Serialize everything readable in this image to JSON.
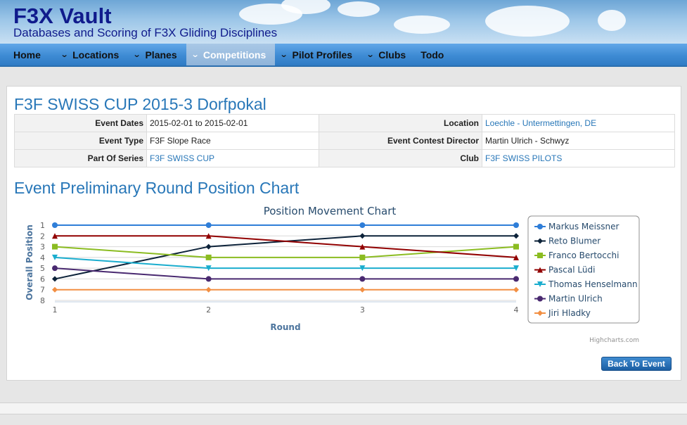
{
  "site": {
    "title": "F3X Vault",
    "subtitle": "Databases and Scoring of F3X Gliding Disciplines"
  },
  "nav": {
    "items": [
      {
        "label": "Home",
        "dropdown": false,
        "active": false
      },
      {
        "label": "Locations",
        "dropdown": true,
        "active": false
      },
      {
        "label": "Planes",
        "dropdown": true,
        "active": false
      },
      {
        "label": "Competitions",
        "dropdown": true,
        "active": true
      },
      {
        "label": "Pilot Profiles",
        "dropdown": true,
        "active": false
      },
      {
        "label": "Clubs",
        "dropdown": true,
        "active": false
      },
      {
        "label": "Todo",
        "dropdown": false,
        "active": false
      }
    ]
  },
  "event": {
    "title": "F3F SWISS CUP 2015-3 Dorfpokal",
    "dates_label": "Event Dates",
    "dates": "2015-02-01 to 2015-02-01",
    "location_label": "Location",
    "location": "Loechle - Untermettingen, DE",
    "type_label": "Event Type",
    "type": "F3F Slope Race",
    "director_label": "Event Contest Director",
    "director": "Martin Ulrich - Schwyz",
    "series_label": "Part Of Series",
    "series": "F3F SWISS CUP",
    "club_label": "Club",
    "club": "F3F SWISS PILOTS"
  },
  "section_title": "Event Preliminary Round Position Chart",
  "credit": "Highcharts.com",
  "back_button": "Back To Event",
  "chart_data": {
    "type": "line",
    "title": "Position Movement Chart",
    "xlabel": "Round",
    "ylabel": "Overall Position",
    "x": [
      1,
      2,
      3,
      4
    ],
    "ylim": [
      1,
      8
    ],
    "y_reversed": true,
    "y_ticks": [
      1,
      2,
      3,
      4,
      5,
      6,
      7,
      8
    ],
    "legend_position": "right",
    "series": [
      {
        "name": "Markus Meissner",
        "values": [
          1,
          1,
          1,
          1
        ],
        "color": "#2f7ed8",
        "marker": "circle"
      },
      {
        "name": "Reto Blumer",
        "values": [
          6,
          3,
          2,
          2
        ],
        "color": "#0d233a",
        "marker": "diamond"
      },
      {
        "name": "Franco Bertocchi",
        "values": [
          3,
          4,
          4,
          3
        ],
        "color": "#8bbc21",
        "marker": "square"
      },
      {
        "name": "Pascal Lüdi",
        "values": [
          2,
          2,
          3,
          4
        ],
        "color": "#910000",
        "marker": "triangle"
      },
      {
        "name": "Thomas Henselmann",
        "values": [
          4,
          5,
          5,
          5
        ],
        "color": "#1aadce",
        "marker": "triangle-down"
      },
      {
        "name": "Martin Ulrich",
        "values": [
          5,
          6,
          6,
          6
        ],
        "color": "#492970",
        "marker": "circle"
      },
      {
        "name": "Jiri Hladky",
        "values": [
          7,
          7,
          7,
          7
        ],
        "color": "#f28f43",
        "marker": "diamond"
      }
    ]
  }
}
